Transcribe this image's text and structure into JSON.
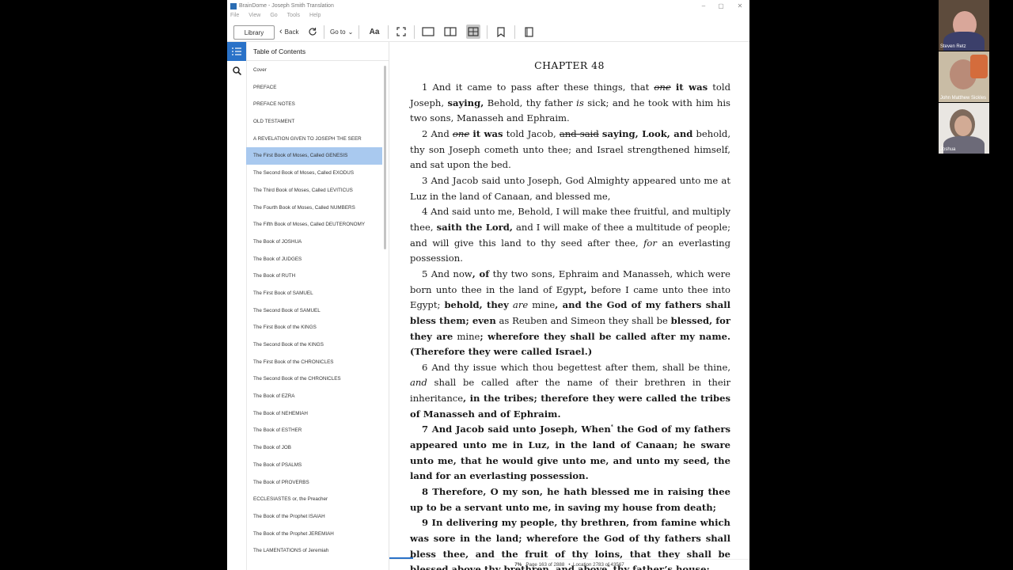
{
  "window": {
    "title": "BrainDome - Joseph Smith Translation"
  },
  "menu": [
    "File",
    "View",
    "Go",
    "Tools",
    "Help"
  ],
  "toolbar": {
    "library": "Library",
    "back": "Back",
    "goto": "Go to",
    "font": "Aa"
  },
  "sidebar": {
    "header": "Table of Contents",
    "items": [
      "Cover",
      "PREFACE",
      "PREFACE NOTES",
      "OLD TESTAMENT",
      "A REVELATION GIVEN TO JOSEPH THE SEER",
      "The First Book of Moses, Called GENESIS",
      "The Second Book of Moses, Called EXODUS",
      "The Third Book of Moses, Called LEVITICUS",
      "The Fourth Book of Moses, Called NUMBERS",
      "The Fifth Book of Moses, Called DEUTERONOMY",
      "The Book of JOSHUA",
      "The Book of JUDGES",
      "The Book of RUTH",
      "The First Book of SAMUEL",
      "The Second Book of SAMUEL",
      "The First Book of the KINGS",
      "The Second Book of the KINGS",
      "The First Book of the CHRONICLES",
      "The Second Book of the CHRONICLES",
      "The Book of EZRA",
      "The Book of NEHEMIAH",
      "The Book of ESTHER",
      "The Book of JOB",
      "The Book of PSALMS",
      "The Book of PROVERBS",
      "ECCLESIASTES or, the Preacher",
      "The Book of the Prophet ISAIAH",
      "The Book of the Prophet JEREMIAH",
      "The LAMENTATIONS of Jeremiah"
    ]
  },
  "reader": {
    "chapter": "CHAPTER 48",
    "status": {
      "percent": "7%",
      "page": "Page 163 of 2888",
      "location": "Location 2783 of 43567"
    }
  },
  "participants": [
    "Steven Retz",
    "John Matthew Sickles",
    "Joshua"
  ],
  "colors": {
    "accent": "#2a72c8",
    "selected": "#a9c9ef"
  }
}
